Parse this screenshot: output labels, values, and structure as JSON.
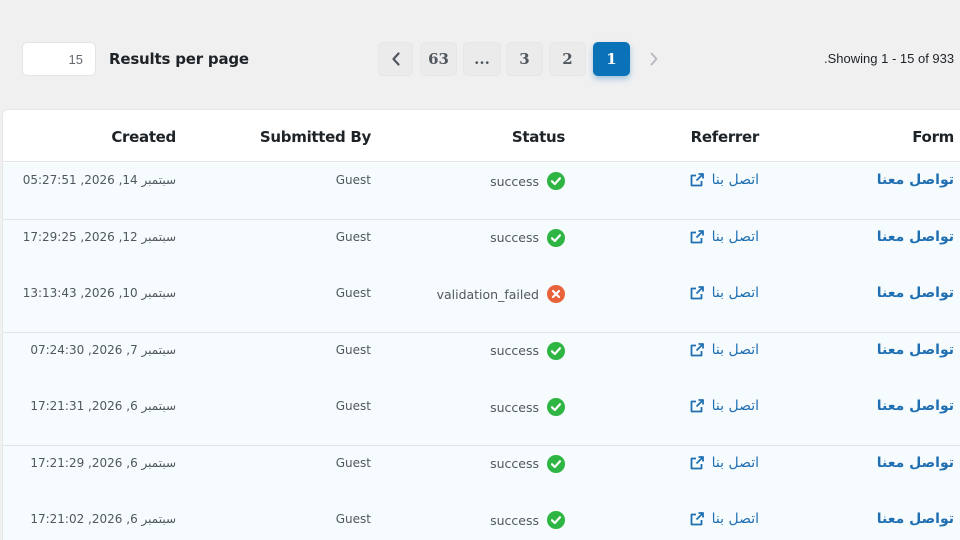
{
  "toolbar": {
    "per_page_value": "15",
    "per_page_label": "Results per page",
    "showing_text": "Showing 1 - 15 of 933."
  },
  "pagination": {
    "prev_icon": "chevron-left-icon",
    "next_icon": "chevron-right-icon",
    "pages": [
      "63",
      "...",
      "3",
      "2",
      "1"
    ],
    "current": "1"
  },
  "table": {
    "columns": {
      "created": "Created",
      "submitted_by": "Submitted By",
      "status": "Status",
      "referrer": "Referrer",
      "form": "Form"
    },
    "rows": [
      {
        "created": "سبتمبر 14, 2026, 05:27:51",
        "submitted_by": "Guest",
        "status": "success",
        "status_type": "ok",
        "referrer": "اتصل بنا",
        "form": "تواصل معنا"
      },
      {
        "created": "سبتمبر 12, 2026, 17:29:25",
        "submitted_by": "Guest",
        "status": "success",
        "status_type": "ok",
        "referrer": "اتصل بنا",
        "form": "تواصل معنا"
      },
      {
        "created": "سبتمبر 10, 2026, 13:13:43",
        "submitted_by": "Guest",
        "status": "validation_failed",
        "status_type": "error",
        "referrer": "اتصل بنا",
        "form": "تواصل معنا"
      },
      {
        "created": "سبتمبر 7, 2026, 07:24:30",
        "submitted_by": "Guest",
        "status": "success",
        "status_type": "ok",
        "referrer": "اتصل بنا",
        "form": "تواصل معنا"
      },
      {
        "created": "سبتمبر 6, 2026, 17:21:31",
        "submitted_by": "Guest",
        "status": "success",
        "status_type": "ok",
        "referrer": "اتصل بنا",
        "form": "تواصل معنا"
      },
      {
        "created": "سبتمبر 6, 2026, 17:21:29",
        "submitted_by": "Guest",
        "status": "success",
        "status_type": "ok",
        "referrer": "اتصل بنا",
        "form": "تواصل معنا"
      },
      {
        "created": "سبتمبر 6, 2026, 17:21:02",
        "submitted_by": "Guest",
        "status": "success",
        "status_type": "ok",
        "referrer": "اتصل بنا",
        "form": "تواصل معنا"
      }
    ]
  },
  "colors": {
    "accent": "#0a73b8",
    "link": "#1f6fb2",
    "success": "#2fb543",
    "error": "#e8623a",
    "row_bg": "#f6fbfd"
  }
}
